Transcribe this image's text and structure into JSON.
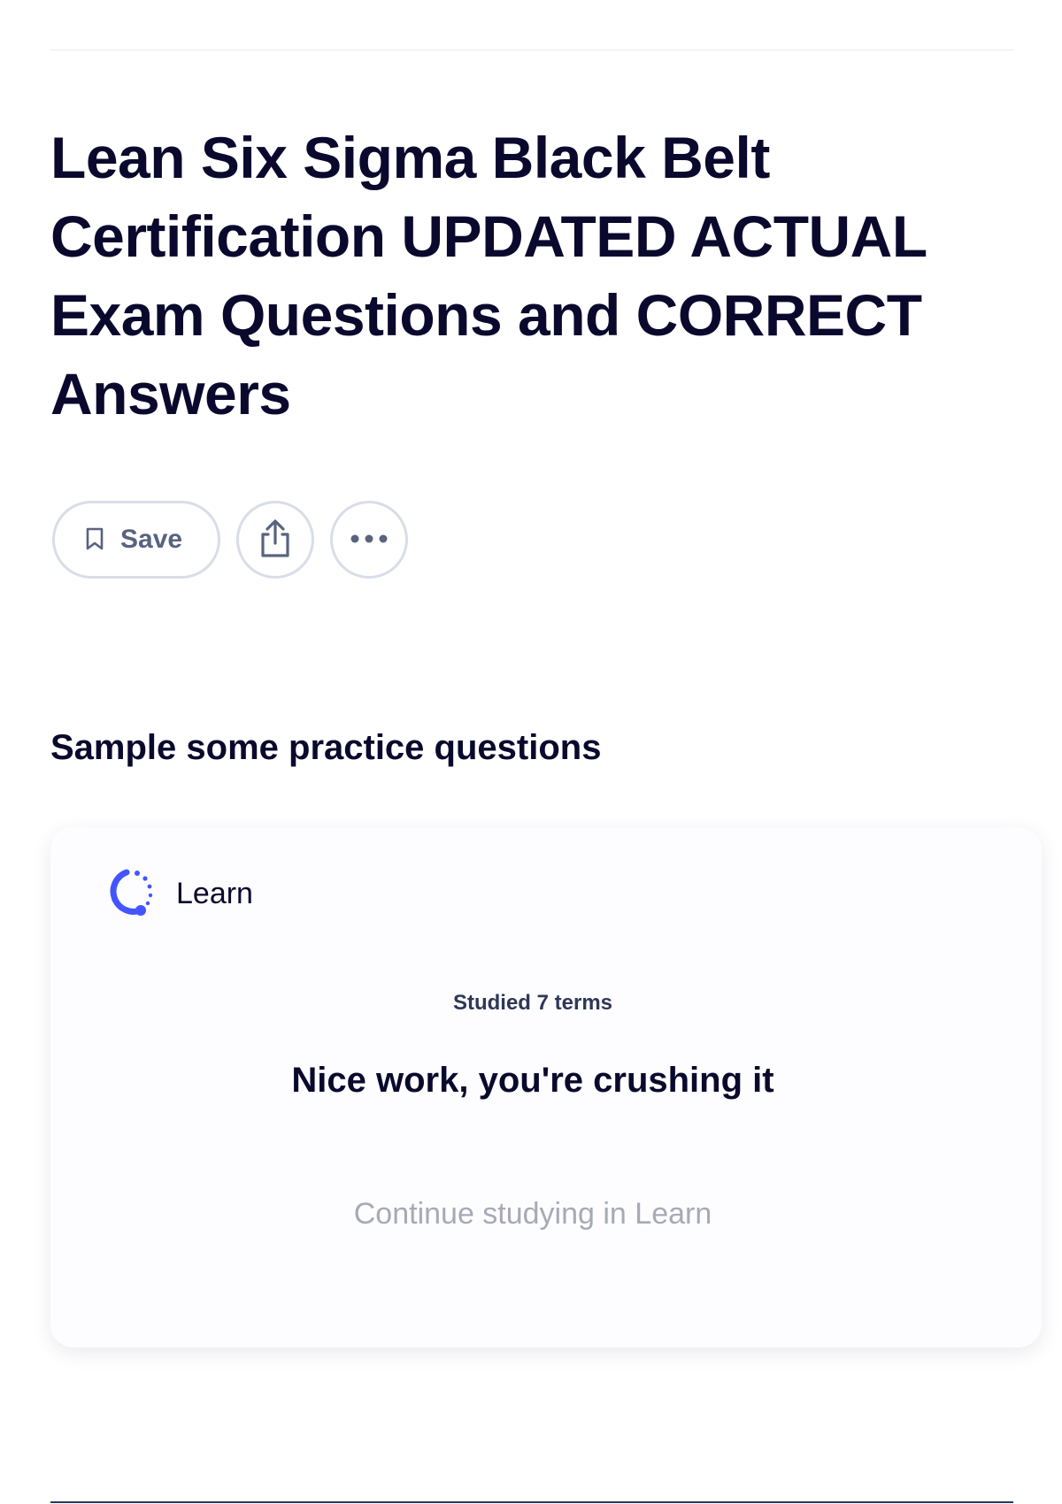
{
  "page": {
    "title": "Lean Six Sigma Black Belt Certification UPDATED ACTUAL Exam Questions and CORRECT Answers"
  },
  "actions": {
    "save_label": "Save",
    "save_icon": "bookmark-icon",
    "share_icon": "share-icon",
    "more_icon": "more-options-icon"
  },
  "practice": {
    "heading": "Sample some practice questions",
    "card": {
      "mode_label": "Learn",
      "mode_icon": "learn-icon",
      "studied_text": "Studied 7 terms",
      "message": "Nice work, you're crushing it",
      "continue_label": "Continue studying in Learn"
    }
  },
  "colors": {
    "accent": "#4255ff",
    "muted_text": "#a7aab5",
    "title_text": "#0a092d",
    "border": "#d9dde8"
  }
}
